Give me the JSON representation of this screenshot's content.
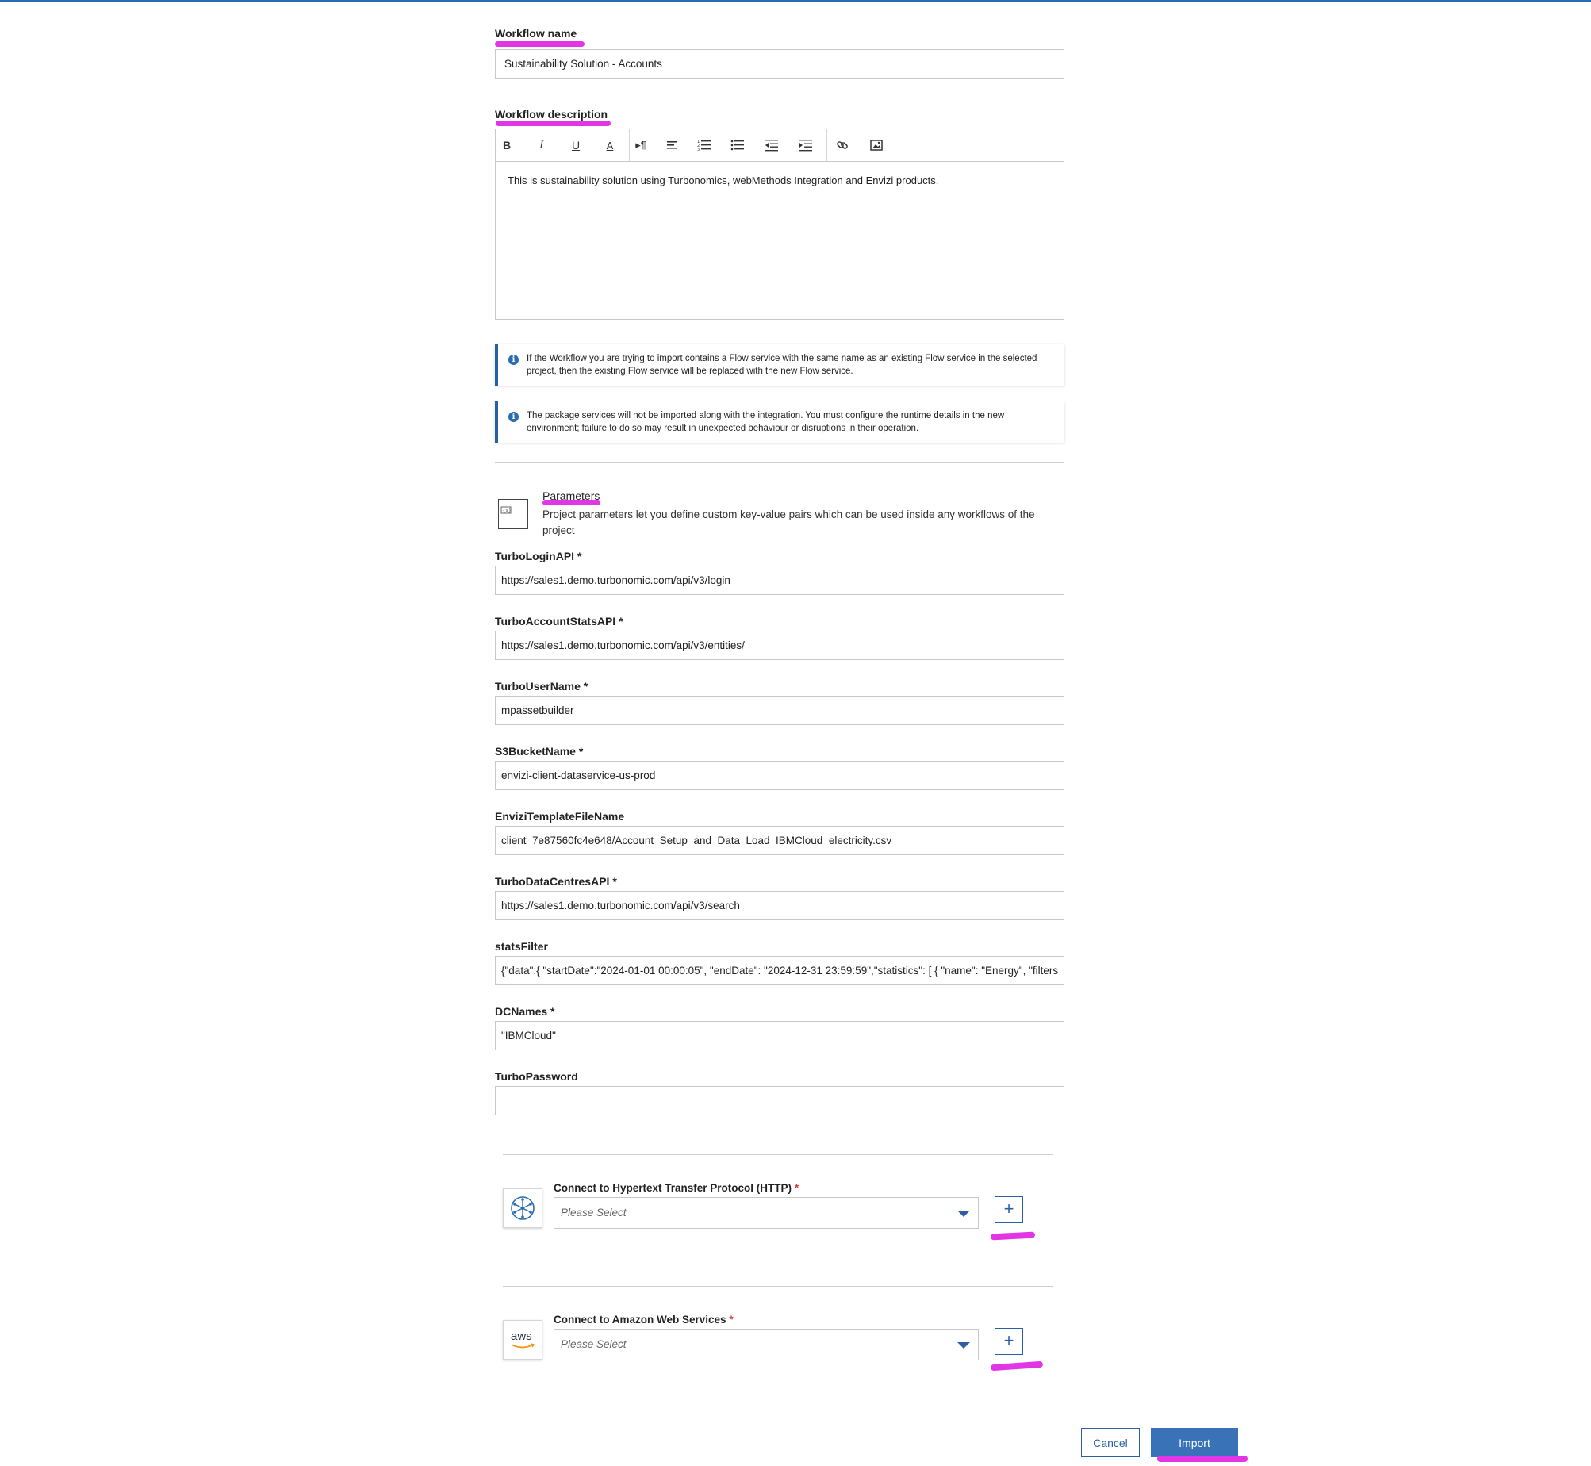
{
  "workflow": {
    "name_label": "Workflow name",
    "name_value": "Sustainability Solution - Accounts",
    "description_label": "Workflow description",
    "description_value": "This is sustainability solution using Turbonomics, webMethods Integration and Envizi products."
  },
  "toolbar": {
    "bold": "B",
    "italic": "I",
    "underline": "U",
    "font_color": "A",
    "paragraph": "▸¶"
  },
  "notices": [
    {
      "text": "If the Workflow you are trying to import contains a Flow service with the same name as an existing Flow service in the selected project, then the existing Flow service will be replaced with the new Flow service."
    },
    {
      "text": "The package services will not be imported along with the integration. You must configure the runtime details in the new environment; failure to do so may result in unexpected behaviour or disruptions in their operation."
    }
  ],
  "parameters": {
    "title": "Parameters",
    "description": "Project parameters let you define custom key-value pairs which can be used inside any workflows of the project",
    "fields": [
      {
        "label": "TurboLoginAPI",
        "required_mark": "*",
        "value": "https://sales1.demo.turbonomic.com/api/v3/login"
      },
      {
        "label": "TurboAccountStatsAPI",
        "required_mark": "*",
        "value": "https://sales1.demo.turbonomic.com/api/v3/entities/"
      },
      {
        "label": "TurboUserName",
        "required_mark": "*",
        "value": "mpassetbuilder"
      },
      {
        "label": "S3BucketName",
        "required_mark": "*",
        "value": "envizi-client-dataservice-us-prod"
      },
      {
        "label": "EnviziTemplateFileName",
        "required_mark": "",
        "value": "client_7e87560fc4e648/Account_Setup_and_Data_Load_IBMCloud_electricity.csv"
      },
      {
        "label": "TurboDataCentresAPI",
        "required_mark": "*",
        "value": "https://sales1.demo.turbonomic.com/api/v3/search"
      },
      {
        "label": "statsFilter",
        "required_mark": "",
        "value": "{\"data\":{ \"startDate\":\"2024-01-01 00:00:05\", \"endDate\": \"2024-12-31 23:59:59\",\"statistics\": [ { \"name\": \"Energy\", \"filters"
      },
      {
        "label": "DCNames",
        "required_mark": "*",
        "value": "\"IBMCloud\""
      },
      {
        "label": "TurboPassword",
        "required_mark": "",
        "value": ""
      }
    ]
  },
  "connections": [
    {
      "label": "Connect to Hypertext Transfer Protocol (HTTP)",
      "required_mark": "*",
      "placeholder": "Please Select",
      "add": "+"
    },
    {
      "label": "Connect to Amazon Web Services",
      "required_mark": "*",
      "placeholder": "Please Select",
      "add": "+",
      "logo_text": "aws"
    }
  ],
  "footer": {
    "cancel_label": "Cancel",
    "import_label": "Import"
  },
  "colors": {
    "accent": "#2b5fa5",
    "primary_button": "#3a72b8",
    "highlight": "#e236e6"
  }
}
